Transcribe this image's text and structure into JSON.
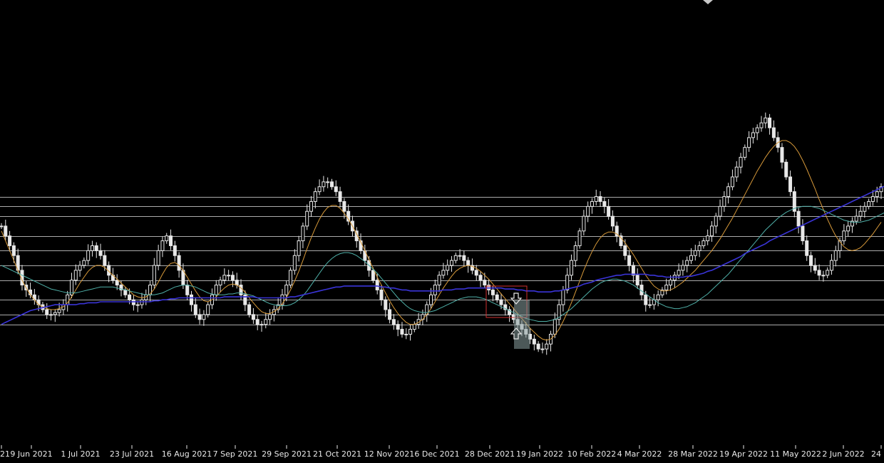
{
  "chart_data": {
    "type": "line",
    "series": [
      {
        "values": [
          1.6,
          1.59,
          1.58,
          1.57,
          1.555,
          1.54,
          1.535,
          1.53,
          1.525,
          1.52,
          1.515,
          1.51,
          1.51,
          1.512,
          1.515,
          1.52,
          1.53,
          1.545,
          1.555,
          1.56,
          1.565,
          1.575,
          1.58,
          1.575,
          1.57,
          1.56,
          1.55,
          1.545,
          1.54,
          1.535,
          1.53,
          1.525,
          1.52,
          1.52,
          1.525,
          1.53,
          1.54,
          1.56,
          1.575,
          1.585,
          1.59,
          1.58,
          1.57,
          1.555,
          1.54,
          1.53,
          1.52,
          1.51,
          1.505,
          1.51,
          1.52,
          1.53,
          1.54,
          1.545,
          1.55,
          1.55,
          1.545,
          1.54,
          1.53,
          1.52,
          1.51,
          1.505,
          1.5,
          1.5,
          1.505,
          1.51,
          1.515,
          1.52,
          1.53,
          1.54,
          1.555,
          1.57,
          1.585,
          1.6,
          1.615,
          1.625,
          1.635,
          1.64,
          1.645,
          1.645,
          1.64,
          1.635,
          1.625,
          1.615,
          1.605,
          1.595,
          1.585,
          1.575,
          1.565,
          1.555,
          1.545,
          1.535,
          1.525,
          1.515,
          1.505,
          1.5,
          1.495,
          1.49,
          1.49,
          1.495,
          1.5,
          1.505,
          1.51,
          1.52,
          1.53,
          1.54,
          1.55,
          1.555,
          1.56,
          1.565,
          1.57,
          1.57,
          1.565,
          1.56,
          1.555,
          1.55,
          1.545,
          1.54,
          1.535,
          1.53,
          1.525,
          1.52,
          1.515,
          1.51,
          1.505,
          1.5,
          1.495,
          1.49,
          1.485,
          1.48,
          1.475,
          1.475,
          1.48,
          1.49,
          1.505,
          1.52,
          1.535,
          1.55,
          1.565,
          1.58,
          1.595,
          1.61,
          1.62,
          1.625,
          1.63,
          1.625,
          1.62,
          1.61,
          1.6,
          1.59,
          1.58,
          1.57,
          1.56,
          1.55,
          1.54,
          1.53,
          1.52,
          1.52,
          1.525,
          1.53,
          1.535,
          1.54,
          1.545,
          1.55,
          1.555,
          1.56,
          1.565,
          1.57,
          1.575,
          1.58,
          1.585,
          1.59,
          1.6,
          1.61,
          1.62,
          1.63,
          1.64,
          1.65,
          1.66,
          1.67,
          1.68,
          1.69,
          1.695,
          1.7,
          1.705,
          1.71,
          1.7,
          1.69,
          1.68,
          1.665,
          1.65,
          1.635,
          1.615,
          1.6,
          1.585,
          1.57,
          1.56,
          1.555,
          1.55,
          1.55,
          1.555,
          1.565,
          1.575,
          1.585,
          1.595,
          1.6,
          1.605,
          1.61,
          1.615,
          1.62,
          1.625,
          1.63,
          1.635,
          1.64
        ],
        "color": "#e8e8e8"
      },
      {
        "values": [
          1.595,
          1.585,
          1.575,
          1.565,
          1.555,
          1.545,
          1.537,
          1.53,
          1.525,
          1.52,
          1.518,
          1.516,
          1.515,
          1.515,
          1.516,
          1.518,
          1.522,
          1.528,
          1.535,
          1.542,
          1.548,
          1.554,
          1.558,
          1.56,
          1.56,
          1.558,
          1.554,
          1.55,
          1.546,
          1.542,
          1.538,
          1.534,
          1.53,
          1.528,
          1.527,
          1.528,
          1.531,
          1.536,
          1.543,
          1.551,
          1.558,
          1.562,
          1.563,
          1.56,
          1.555,
          1.548,
          1.541,
          1.534,
          1.528,
          1.524,
          1.523,
          1.525,
          1.528,
          1.533,
          1.537,
          1.54,
          1.541,
          1.54,
          1.537,
          1.533,
          1.527,
          1.522,
          1.517,
          1.513,
          1.511,
          1.511,
          1.513,
          1.516,
          1.521,
          1.527,
          1.535,
          1.544,
          1.554,
          1.565,
          1.577,
          1.588,
          1.598,
          1.607,
          1.614,
          1.619,
          1.621,
          1.621,
          1.618,
          1.613,
          1.607,
          1.6,
          1.592,
          1.584,
          1.575,
          1.566,
          1.557,
          1.548,
          1.54,
          1.532,
          1.524,
          1.517,
          1.511,
          1.506,
          1.502,
          1.5,
          1.5,
          1.502,
          1.505,
          1.51,
          1.516,
          1.523,
          1.53,
          1.537,
          1.543,
          1.549,
          1.554,
          1.557,
          1.559,
          1.56,
          1.559,
          1.557,
          1.554,
          1.55,
          1.546,
          1.541,
          1.536,
          1.531,
          1.526,
          1.521,
          1.516,
          1.511,
          1.506,
          1.501,
          1.496,
          1.492,
          1.488,
          1.485,
          1.484,
          1.485,
          1.489,
          1.495,
          1.503,
          1.512,
          1.522,
          1.533,
          1.544,
          1.555,
          1.565,
          1.574,
          1.582,
          1.588,
          1.592,
          1.594,
          1.594,
          1.592,
          1.588,
          1.583,
          1.577,
          1.571,
          1.564,
          1.557,
          1.55,
          1.544,
          1.539,
          1.536,
          1.534,
          1.534,
          1.535,
          1.537,
          1.54,
          1.543,
          1.547,
          1.551,
          1.555,
          1.56,
          1.565,
          1.57,
          1.575,
          1.581,
          1.587,
          1.594,
          1.601,
          1.608,
          1.616,
          1.624,
          1.632,
          1.64,
          1.648,
          1.656,
          1.663,
          1.67,
          1.676,
          1.681,
          1.685,
          1.687,
          1.687,
          1.685,
          1.681,
          1.675,
          1.667,
          1.658,
          1.648,
          1.638,
          1.627,
          1.617,
          1.607,
          1.598,
          1.59,
          1.584,
          1.579,
          1.576,
          1.575,
          1.576,
          1.578,
          1.582,
          1.587,
          1.592,
          1.598,
          1.604
        ],
        "color": "#d89a3a"
      },
      {
        "values": [
          1.56,
          1.558,
          1.556,
          1.554,
          1.552,
          1.55,
          1.548,
          1.546,
          1.544,
          1.542,
          1.54,
          1.538,
          1.536,
          1.535,
          1.534,
          1.533,
          1.532,
          1.532,
          1.532,
          1.533,
          1.534,
          1.535,
          1.536,
          1.537,
          1.538,
          1.538,
          1.538,
          1.538,
          1.537,
          1.536,
          1.535,
          1.534,
          1.533,
          1.532,
          1.531,
          1.53,
          1.53,
          1.53,
          1.531,
          1.532,
          1.534,
          1.536,
          1.538,
          1.539,
          1.54,
          1.54,
          1.539,
          1.538,
          1.536,
          1.534,
          1.532,
          1.531,
          1.53,
          1.53,
          1.53,
          1.531,
          1.531,
          1.532,
          1.532,
          1.531,
          1.53,
          1.529,
          1.527,
          1.525,
          1.523,
          1.521,
          1.52,
          1.519,
          1.519,
          1.519,
          1.52,
          1.522,
          1.525,
          1.529,
          1.534,
          1.54,
          1.546,
          1.552,
          1.558,
          1.563,
          1.567,
          1.57,
          1.572,
          1.573,
          1.573,
          1.572,
          1.57,
          1.567,
          1.564,
          1.56,
          1.556,
          1.552,
          1.547,
          1.542,
          1.537,
          1.532,
          1.527,
          1.523,
          1.519,
          1.516,
          1.514,
          1.513,
          1.512,
          1.512,
          1.513,
          1.514,
          1.516,
          1.518,
          1.52,
          1.522,
          1.524,
          1.526,
          1.527,
          1.528,
          1.528,
          1.528,
          1.527,
          1.526,
          1.524,
          1.522,
          1.52,
          1.518,
          1.516,
          1.514,
          1.512,
          1.51,
          1.508,
          1.506,
          1.505,
          1.504,
          1.503,
          1.503,
          1.503,
          1.504,
          1.505,
          1.507,
          1.51,
          1.513,
          1.516,
          1.52,
          1.524,
          1.528,
          1.532,
          1.536,
          1.539,
          1.542,
          1.544,
          1.545,
          1.546,
          1.546,
          1.545,
          1.544,
          1.542,
          1.54,
          1.537,
          1.534,
          1.531,
          1.528,
          1.525,
          1.522,
          1.52,
          1.518,
          1.517,
          1.516,
          1.516,
          1.517,
          1.518,
          1.52,
          1.522,
          1.525,
          1.528,
          1.531,
          1.535,
          1.539,
          1.543,
          1.547,
          1.551,
          1.556,
          1.561,
          1.566,
          1.571,
          1.576,
          1.581,
          1.586,
          1.591,
          1.596,
          1.6,
          1.604,
          1.608,
          1.611,
          1.614,
          1.616,
          1.618,
          1.619,
          1.62,
          1.62,
          1.62,
          1.619,
          1.618,
          1.616,
          1.614,
          1.612,
          1.61,
          1.608,
          1.606,
          1.605,
          1.604,
          1.604,
          1.604,
          1.605,
          1.606,
          1.608,
          1.61,
          1.612,
          1.614,
          1.616
        ],
        "color": "#4fb0a8"
      },
      {
        "values": [
          1.5,
          1.502,
          1.504,
          1.506,
          1.508,
          1.51,
          1.512,
          1.514,
          1.515,
          1.516,
          1.517,
          1.518,
          1.519,
          1.52,
          1.52,
          1.52,
          1.52,
          1.52,
          1.52,
          1.521,
          1.521,
          1.522,
          1.522,
          1.522,
          1.523,
          1.523,
          1.523,
          1.523,
          1.523,
          1.523,
          1.523,
          1.523,
          1.523,
          1.523,
          1.523,
          1.523,
          1.523,
          1.524,
          1.524,
          1.525,
          1.525,
          1.526,
          1.526,
          1.527,
          1.527,
          1.527,
          1.527,
          1.527,
          1.527,
          1.527,
          1.527,
          1.527,
          1.527,
          1.527,
          1.528,
          1.528,
          1.528,
          1.528,
          1.528,
          1.528,
          1.528,
          1.528,
          1.527,
          1.527,
          1.527,
          1.527,
          1.527,
          1.527,
          1.527,
          1.527,
          1.528,
          1.528,
          1.529,
          1.53,
          1.531,
          1.532,
          1.533,
          1.534,
          1.535,
          1.536,
          1.537,
          1.538,
          1.538,
          1.539,
          1.539,
          1.539,
          1.539,
          1.539,
          1.539,
          1.539,
          1.539,
          1.539,
          1.538,
          1.538,
          1.537,
          1.537,
          1.536,
          1.535,
          1.535,
          1.534,
          1.534,
          1.534,
          1.534,
          1.534,
          1.534,
          1.534,
          1.534,
          1.535,
          1.535,
          1.535,
          1.536,
          1.536,
          1.536,
          1.537,
          1.537,
          1.537,
          1.537,
          1.537,
          1.537,
          1.537,
          1.537,
          1.537,
          1.536,
          1.536,
          1.536,
          1.535,
          1.535,
          1.534,
          1.534,
          1.534,
          1.533,
          1.533,
          1.533,
          1.533,
          1.534,
          1.534,
          1.535,
          1.536,
          1.537,
          1.538,
          1.539,
          1.541,
          1.542,
          1.543,
          1.545,
          1.546,
          1.547,
          1.548,
          1.549,
          1.55,
          1.55,
          1.551,
          1.551,
          1.551,
          1.551,
          1.551,
          1.551,
          1.55,
          1.55,
          1.549,
          1.549,
          1.548,
          1.548,
          1.548,
          1.548,
          1.548,
          1.549,
          1.549,
          1.55,
          1.551,
          1.552,
          1.554,
          1.555,
          1.557,
          1.559,
          1.561,
          1.563,
          1.565,
          1.567,
          1.569,
          1.572,
          1.574,
          1.576,
          1.578,
          1.58,
          1.582,
          1.585,
          1.587,
          1.589,
          1.591,
          1.593,
          1.595,
          1.597,
          1.599,
          1.601,
          1.603,
          1.605,
          1.607,
          1.609,
          1.611,
          1.613,
          1.615,
          1.617,
          1.619,
          1.621,
          1.623,
          1.625,
          1.627,
          1.629,
          1.631,
          1.633,
          1.635,
          1.637,
          1.639,
          1.641
        ],
        "color": "#3a34d8"
      }
    ],
    "candles": {
      "color": "#e8e8e8",
      "step": 0.005,
      "close_overrides": []
    },
    "horizontal_levels": [
      1.63,
      1.62,
      1.61,
      1.59,
      1.575,
      1.56,
      1.545,
      1.525,
      1.51,
      1.5
    ],
    "x_ticks": [
      "21",
      "9 Jun 2021",
      "1 Jul 2021",
      "23 Jul 2021",
      "16 Aug 2021",
      "7 Sep 2021",
      "29 Sep 2021",
      "21 Oct 2021",
      "12 Nov 2021",
      "6 Dec 2021",
      "28 Dec 2021",
      "19 Jan 2022",
      "10 Feb 2022",
      "4 Mar 2022",
      "28 Mar 2022",
      "19 Apr 2022",
      "11 May 2022",
      "2 Jun 2022",
      "24"
    ],
    "grid": false,
    "colors": {
      "background": "#000000",
      "level_line": "#c8c8c8",
      "selection_box": "#d03030",
      "highlight_rect": "#8aa0a0",
      "arrow": "#e8e8e8"
    },
    "annotations": {
      "selection_box": {
        "x_start": "28 Dec 2021",
        "x_end": "19 Jan 2022"
      },
      "highlight_rect": {
        "x_start": "19 Jan 2022"
      },
      "arrows": [
        "down-arrow-icon",
        "up-arrow-icon"
      ],
      "marker": "diamond-icon"
    }
  }
}
